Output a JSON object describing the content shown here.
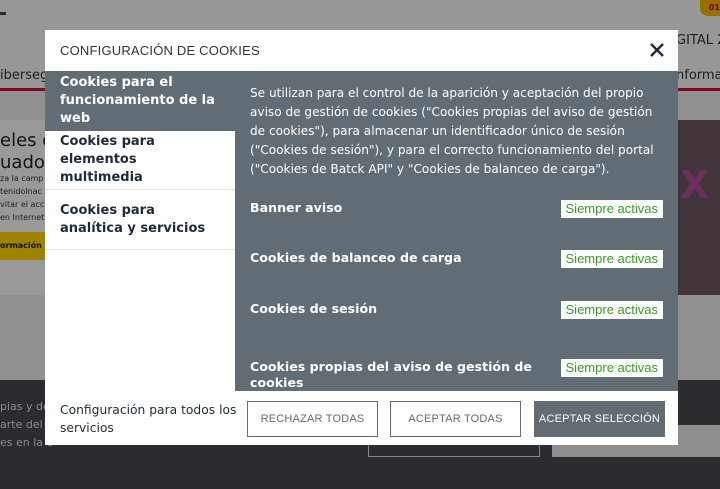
{
  "background": {
    "badge": "01",
    "header_right": "GITAL 2",
    "nav_left": "iberseg",
    "nav_right": "nformac",
    "hero_title_lines": [
      "eles de",
      "uados"
    ],
    "hero_text_lines": [
      "za la camp",
      "tenidolnac",
      "vitar el acc",
      "en Internet"
    ],
    "hero_button": "ormación",
    "footer_lines": [
      "pias y de",
      "arte del v",
      "es en la c"
    ]
  },
  "modal": {
    "title": "CONFIGURACIÓN DE COOKIES",
    "close_icon": "close-icon",
    "tabs": [
      {
        "label": "Cookies para el funcionamiento de la web",
        "active": true
      },
      {
        "label": "Cookies para elementos multimedia",
        "active": false
      },
      {
        "label": "Cookies para analítica y servicios",
        "active": false
      }
    ],
    "description": "Se utilizan para el control de la aparición y aceptación del propio aviso de gestión de cookies (\"Cookies propias del aviso de gestión de cookies\"), para almacenar un identificador único de sesión (\"Cookies de sesión\"), y para el correcto funcionamiento del portal (\"Cookies de Batck API\" y \"Cookies de balanceo de carga\").",
    "categories": [
      {
        "name": "Banner aviso",
        "status": "Siempre activas"
      },
      {
        "name": "Cookies de balanceo de carga",
        "status": "Siempre activas"
      },
      {
        "name": "Cookies de sesión",
        "status": "Siempre activas"
      },
      {
        "name": "Cookies propias del aviso de gestión de cookies",
        "status": "Siempre activas"
      }
    ],
    "footer": {
      "label": "Configuración para todos los servicios",
      "reject_all": "RECHAZAR TODAS",
      "accept_all": "ACEPTAR TODAS",
      "accept_selection": "ACEPTAR SELECCIÓN"
    },
    "colors": {
      "panel": "#616c74",
      "status_text": "#3a9b27",
      "tab_text": "#1f2b3a"
    }
  }
}
